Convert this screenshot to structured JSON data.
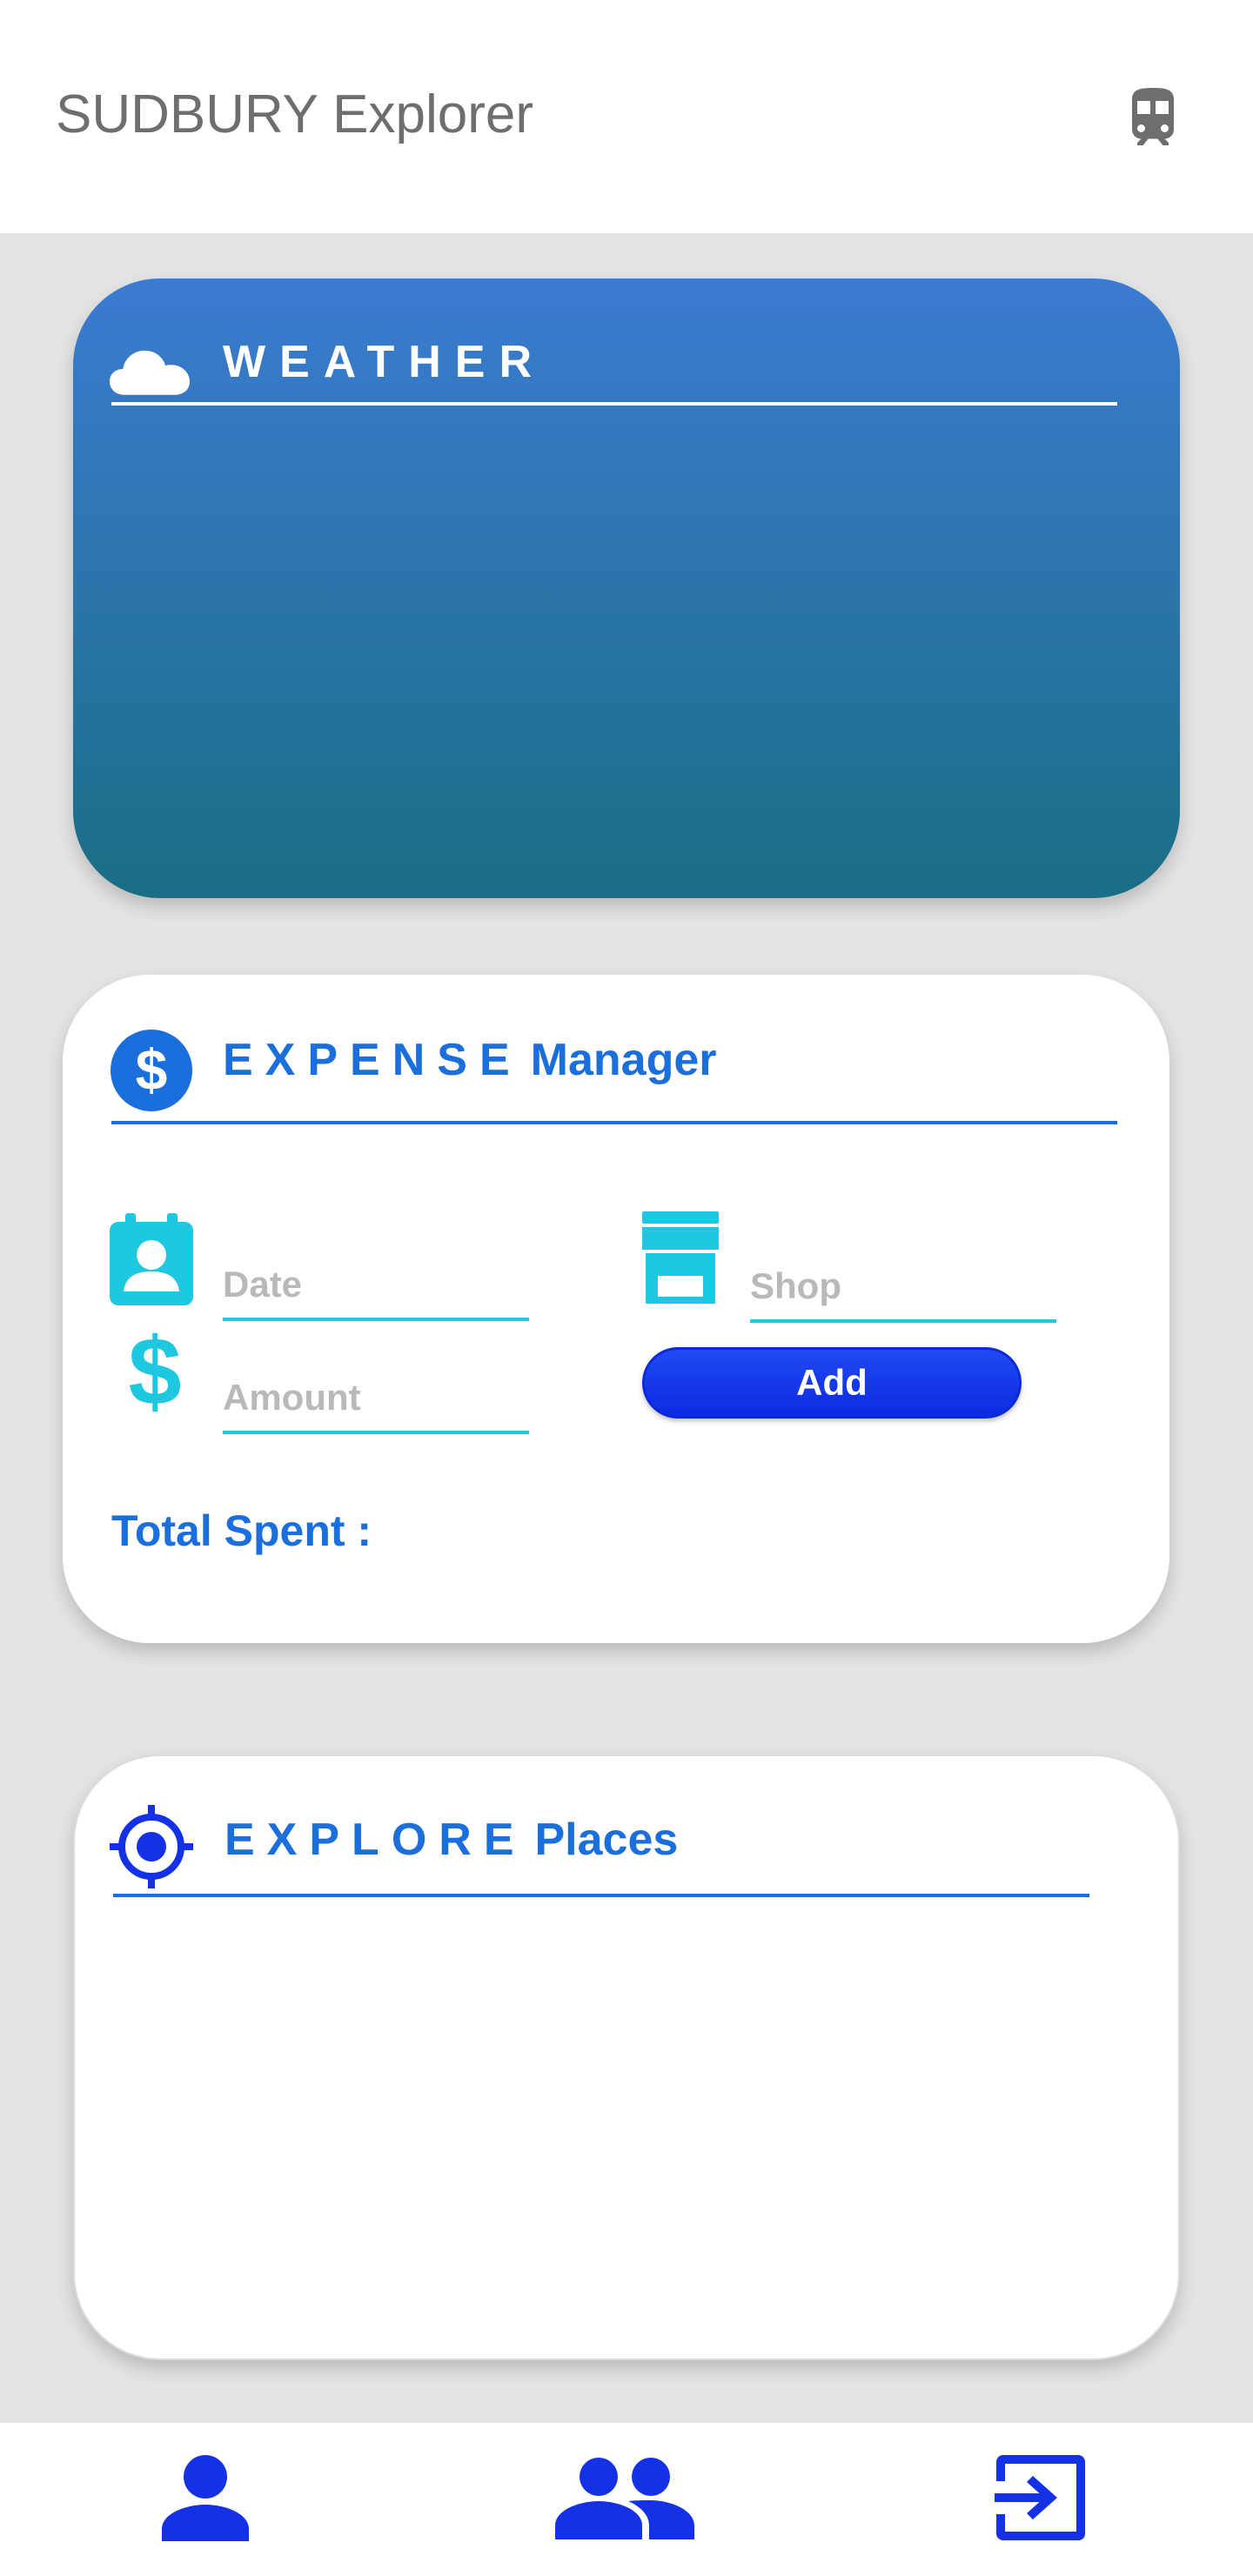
{
  "app": {
    "title": "SUDBURY Explorer",
    "train_icon": "train-icon"
  },
  "weather": {
    "icon": "cloud-icon",
    "title": "WEATHER",
    "gradient_top": "#3b7bd2",
    "gradient_bottom": "#1a6d85"
  },
  "expense": {
    "icon": "dollar-circle-icon",
    "title_spaced": "EXPENSE",
    "title_word": "Manager",
    "date": {
      "icon": "contact-calendar-icon",
      "placeholder": "Date",
      "value": ""
    },
    "shop": {
      "icon": "storefront-icon",
      "placeholder": "Shop",
      "value": ""
    },
    "amount": {
      "icon": "dollar-icon",
      "placeholder": "Amount",
      "value": ""
    },
    "add_label": "Add",
    "total_label": "Total Spent :"
  },
  "explore": {
    "icon": "gps-target-icon",
    "title_spaced": "EXPLORE",
    "title_word": "Places"
  },
  "nav": {
    "items": [
      {
        "icon": "person-icon"
      },
      {
        "icon": "group-icon"
      },
      {
        "icon": "exit-to-app-icon"
      }
    ]
  },
  "colors": {
    "accent_blue": "#1a6fdc",
    "cyan": "#1ec8e0",
    "button_blue": "#0b2be0",
    "nav_blue": "#1431e6"
  }
}
